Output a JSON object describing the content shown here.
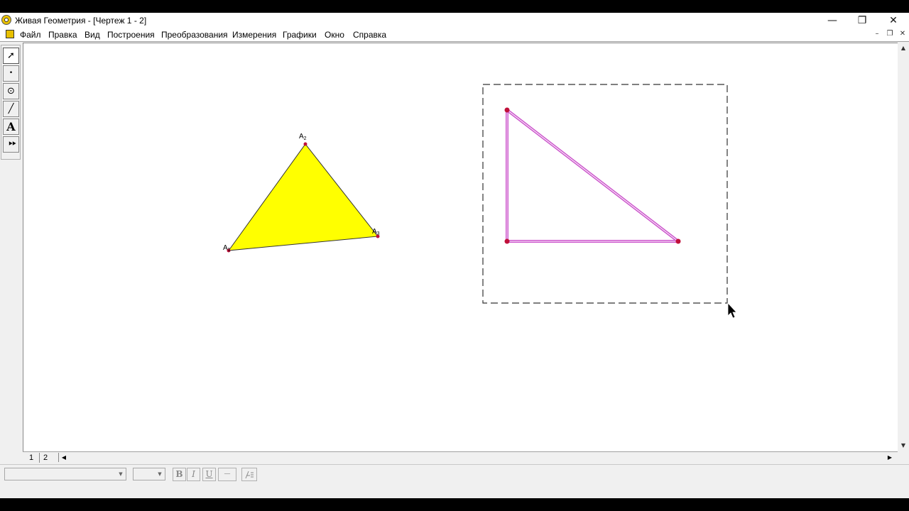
{
  "window": {
    "title": "Живая Геометрия - [Чертеж 1 - 2]",
    "controls": {
      "minimize": "—",
      "restore": "❐",
      "close": "✕"
    }
  },
  "menu": {
    "items": [
      "Файл",
      "Правка",
      "Вид",
      "Построения",
      "Преобразования",
      "Измерения",
      "Графики",
      "Окно",
      "Справка"
    ],
    "mdi": {
      "minimize": "–",
      "restore": "❐",
      "close": "✕"
    }
  },
  "toolbox": {
    "tools": [
      {
        "icon": "arrow-select-icon",
        "glyph": "➚"
      },
      {
        "icon": "point-tool-icon",
        "glyph": "•"
      },
      {
        "icon": "compass-tool-icon",
        "glyph": "⊙"
      },
      {
        "icon": "straightedge-tool-icon",
        "glyph": "╱"
      },
      {
        "icon": "text-tool-icon",
        "glyph": "A"
      },
      {
        "icon": "custom-tool-icon",
        "glyph": "⯈⯈"
      }
    ]
  },
  "canvas": {
    "triangle1": {
      "fill": "#ffff00",
      "labels": {
        "a1": "A",
        "a1_sub": "1",
        "a2": "A",
        "a2_sub": "2",
        "a3": "A",
        "a3_sub": "3"
      }
    },
    "triangle2": {
      "stroke": "#cc55cc",
      "point_color": "#c0103a"
    }
  },
  "pages": {
    "tabs": [
      "1",
      "2"
    ],
    "left_arrow": "◀",
    "right_arrow": "▶"
  },
  "scrollbar": {
    "up": "▲",
    "down": "▼"
  },
  "format": {
    "bold": "B",
    "italic": "I",
    "underline": "U",
    "line": "—",
    "combo_arrow": "▼"
  }
}
